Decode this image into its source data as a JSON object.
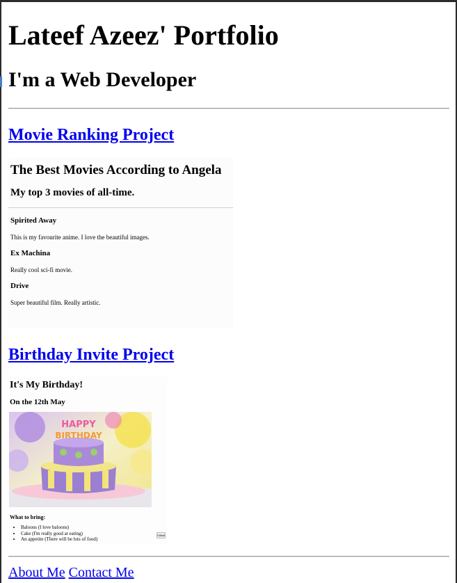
{
  "header": {
    "title": "Lateef Azeez' Portfolio",
    "subtitle": "I'm a Web Developer"
  },
  "projects": [
    {
      "link_label": "Movie Ranking Project",
      "preview": {
        "heading": "The Best Movies According to Angela",
        "subheading": "My top 3 movies of all-time.",
        "movies": [
          {
            "title": "Spirited Away",
            "description": "This is my favourite anime. I love the beautiful images."
          },
          {
            "title": "Ex Machina",
            "description": "Really cool sci-fi movie."
          },
          {
            "title": "Drive",
            "description": "Super beautiful film. Really artistic."
          }
        ]
      }
    },
    {
      "link_label": "Birthday Invite Project",
      "preview": {
        "heading": "It's My Birthday!",
        "date": "On the 12th May",
        "image": "birthday-cake-image",
        "bring_heading": "What to bring:",
        "bring_items": [
          "Baloons (I love baloons)",
          "Cake (I'm really good at eating)",
          "An appetite (There will be lots of food)"
        ],
        "button_label": "Github"
      }
    }
  ],
  "footer": {
    "about_label": "About Me",
    "contact_label": "Contact Me"
  },
  "colors": {
    "link": "#0000ee",
    "rule": "#9a9a9a",
    "frame": "#2b2b2b"
  }
}
